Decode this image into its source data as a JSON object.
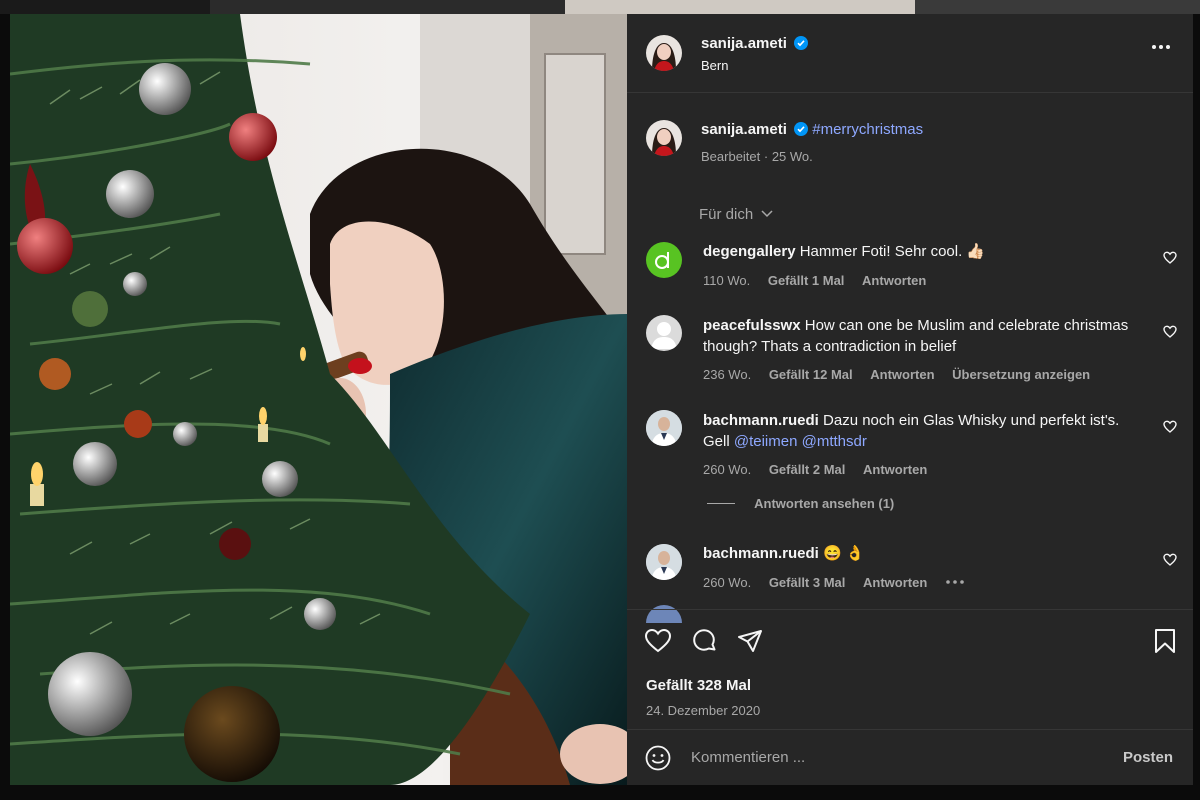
{
  "post": {
    "author": "sanija.ameti",
    "location": "Bern",
    "caption_author": "sanija.ameti",
    "caption_hashtag": "#merrychristmas",
    "caption_meta": "Bearbeitet · 25 Wo.",
    "for_you": "Für dich",
    "likes": "Gefällt 328 Mal",
    "date": "24. Dezember 2020"
  },
  "comments": [
    {
      "user": "degengallery",
      "text": "Hammer Foti! Sehr cool. 👍🏻",
      "age": "110 Wo.",
      "likes": "Gefällt 1 Mal",
      "reply": "Antworten"
    },
    {
      "user": "peacefulsswx",
      "text": "How can one be Muslim and celebrate christmas though? Thats a contradiction in belief",
      "age": "236 Wo.",
      "likes": "Gefällt 12 Mal",
      "reply": "Antworten",
      "translate": "Übersetzung anzeigen"
    },
    {
      "user": "bachmann.ruedi",
      "text": "Dazu noch ein Glas Whisky und perfekt ist's. Gell",
      "mention1": "@teiimen",
      "mention2": "@mtthsdr",
      "age": "260 Wo.",
      "likes": "Gefällt 2 Mal",
      "reply": "Antworten",
      "view_replies": "Antworten ansehen (1)"
    },
    {
      "user": "bachmann.ruedi",
      "text": "😄 👌",
      "age": "260 Wo.",
      "likes": "Gefällt 3 Mal",
      "reply": "Antworten"
    }
  ],
  "composer": {
    "placeholder": "Kommentieren ...",
    "post_label": "Posten"
  },
  "colors": {
    "panel": "#262626",
    "link": "#8ea8ff",
    "verified": "#0095f6"
  }
}
